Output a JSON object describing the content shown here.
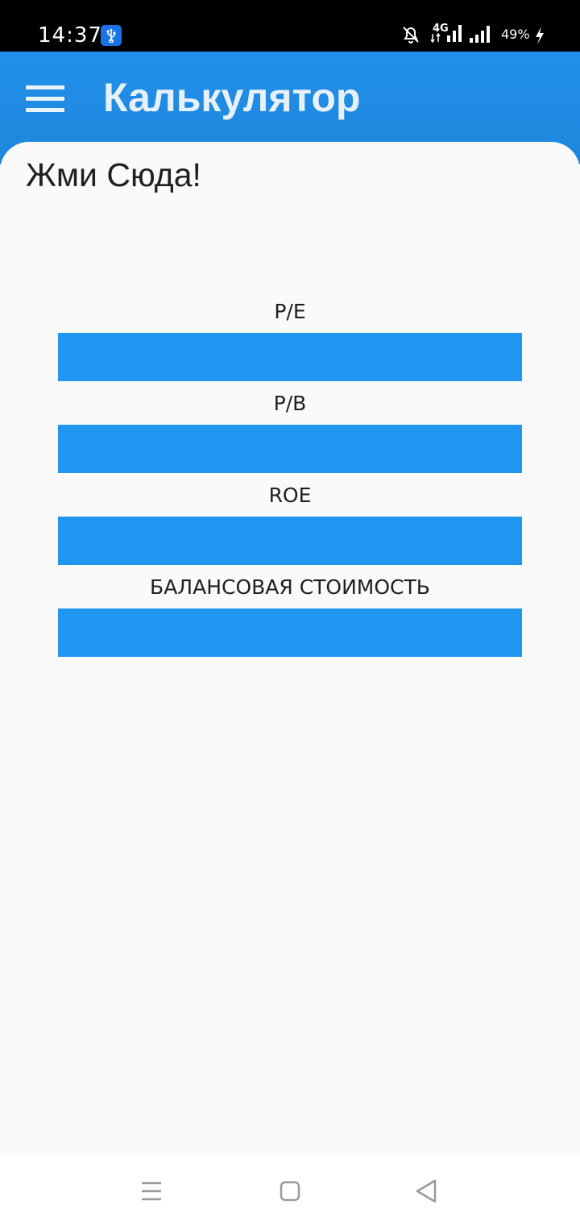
{
  "status_bar": {
    "time": "14:37",
    "network": "4G",
    "battery": "49%"
  },
  "app_bar": {
    "title": "Калькулятор"
  },
  "content": {
    "prompt": "Жми Сюда!",
    "fields": [
      {
        "label": "P/E",
        "value": ""
      },
      {
        "label": "P/B",
        "value": ""
      },
      {
        "label": "ROE",
        "value": ""
      },
      {
        "label": "БАЛАНСОВАЯ СТОИМОСТЬ",
        "value": ""
      }
    ]
  },
  "colors": {
    "primary": "#2090ea",
    "field": "#2196f0",
    "background": "#fafafa"
  }
}
